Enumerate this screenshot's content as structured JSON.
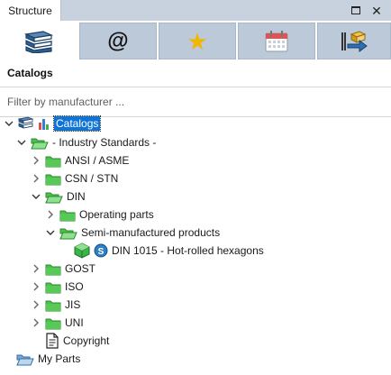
{
  "window": {
    "tab_title": "Structure",
    "maximize_icon": "maximize-icon",
    "close_glyph": "✕"
  },
  "toolbar": {
    "tabs": [
      {
        "icon": "books-icon",
        "active": true
      },
      {
        "icon": "at-sign-icon",
        "glyph": "@",
        "active": false
      },
      {
        "icon": "star-icon",
        "glyph": "★",
        "active": false
      },
      {
        "icon": "calendar-icon",
        "active": false
      },
      {
        "icon": "export-icon",
        "active": false
      }
    ]
  },
  "section": {
    "label": "Catalogs"
  },
  "filter": {
    "placeholder": "Filter by manufacturer ...",
    "value": ""
  },
  "tree": {
    "root": "Catalogs",
    "industry": "- Industry Standards -",
    "ansi": "ANSI / ASME",
    "csn": "CSN / STN",
    "din": "DIN",
    "operating": "Operating parts",
    "semi": "Semi-manufactured products",
    "din1015": "DIN 1015 - Hot-rolled hexagons",
    "gost": "GOST",
    "iso": "ISO",
    "jis": "JIS",
    "uni": "UNI",
    "copyright": "Copyright",
    "myparts": "My Parts"
  },
  "colors": {
    "folder": "#3fb23f",
    "selection": "#0f74d8",
    "tab_inactive": "#bcc9d9",
    "star": "#f2b600"
  }
}
